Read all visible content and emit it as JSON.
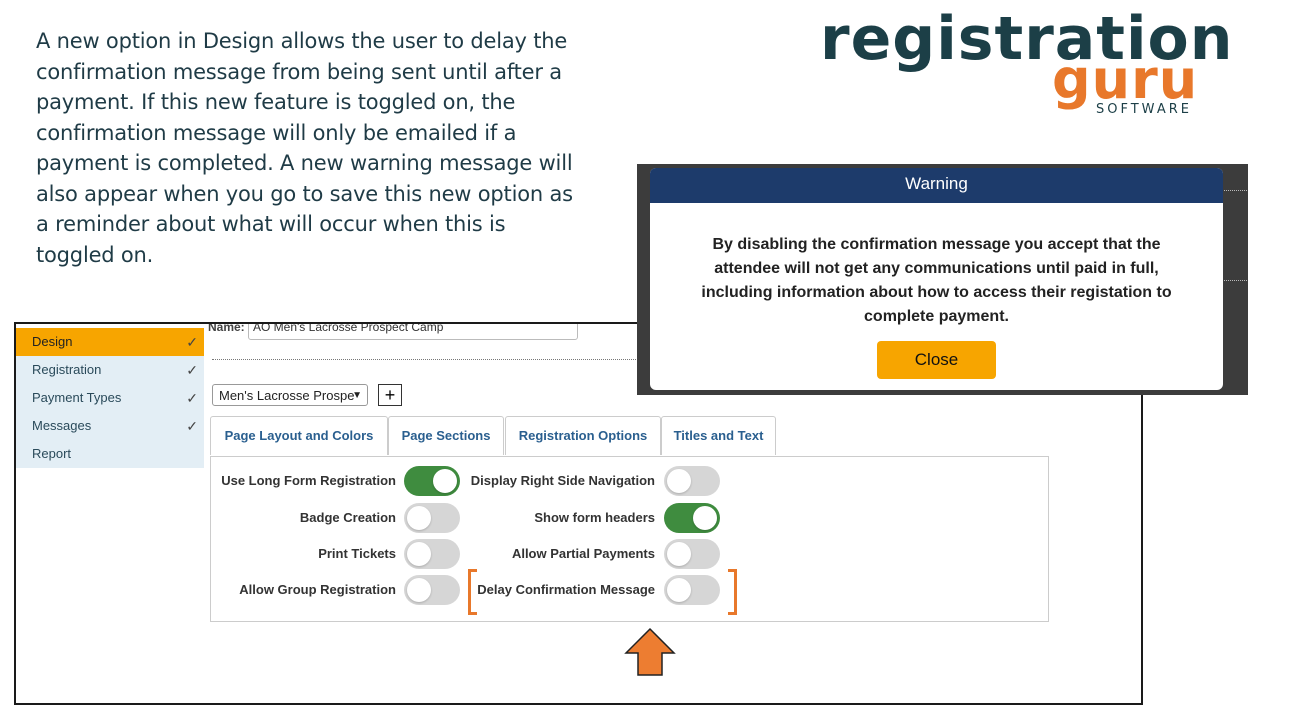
{
  "intro_text": "A new option in Design allows the user to delay the confirmation message from being sent until after a payment.  If this new feature is toggled on, the confirmation message will only be emailed if a payment is completed. A new warning message will also appear when you go to save this new option as a reminder about what will occur when this is toggled on.",
  "logo": {
    "main": "registration",
    "guru": "guru",
    "software": "SOFTWARE"
  },
  "colors": {
    "brand_dark": "#1c3f47",
    "brand_orange": "#e8782b",
    "active_nav": "#f7a500",
    "toggle_on": "#3f8c3f",
    "modal_header": "#1d3b6b"
  },
  "sidebar": {
    "items": [
      {
        "label": "Design",
        "checked": "✓"
      },
      {
        "label": "Registration",
        "checked": "✓"
      },
      {
        "label": "Payment Types",
        "checked": "✓"
      },
      {
        "label": "Messages",
        "checked": "✓"
      },
      {
        "label": "Report",
        "checked": ""
      }
    ]
  },
  "name_field": {
    "label": "Name:",
    "value": "AO Men's Lacrosse Prospect Camp"
  },
  "template_select": {
    "value": "Men's Lacrosse Prospе",
    "add_label": "+"
  },
  "tabs": [
    {
      "label": "Page Layout and Colors"
    },
    {
      "label": "Page Sections"
    },
    {
      "label": "Registration Options"
    },
    {
      "label": "Titles and Text"
    }
  ],
  "options": {
    "left": [
      {
        "label": "Use Long Form Registration",
        "on": true
      },
      {
        "label": "Badge Creation",
        "on": false
      },
      {
        "label": "Print Tickets",
        "on": false
      },
      {
        "label": "Allow Group Registration",
        "on": false
      }
    ],
    "right": [
      {
        "label": "Display Right Side Navigation",
        "on": false
      },
      {
        "label": "Show form headers",
        "on": true
      },
      {
        "label": "Allow Partial Payments",
        "on": false
      },
      {
        "label": "Delay Confirmation Message",
        "on": false
      }
    ]
  },
  "modal": {
    "title": "Warning",
    "body": "By disabling the confirmation message you accept that the attendee will not get any communications until paid in full, including information about how to access their registation to complete payment.",
    "close_label": "Close"
  }
}
